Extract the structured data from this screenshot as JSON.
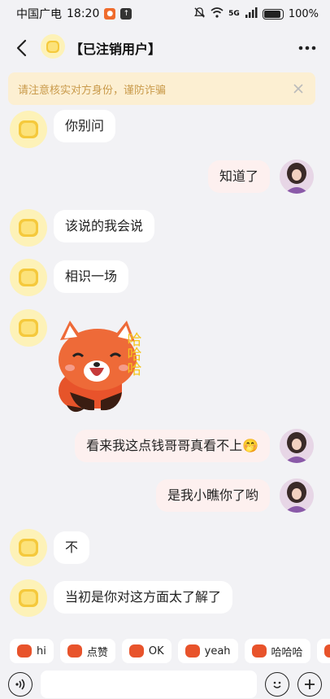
{
  "status_bar": {
    "carrier": "中国广电",
    "time": "18:20",
    "battery": "100%",
    "network": "5G"
  },
  "header": {
    "title": "【已注销用户】"
  },
  "notice": {
    "text": "请注意核实对方身份，谨防诈骗"
  },
  "messages": [
    {
      "side": "left",
      "text": "你别问"
    },
    {
      "side": "right",
      "text": "知道了"
    },
    {
      "side": "left",
      "text": "该说的我会说"
    },
    {
      "side": "left",
      "text": "相识一场"
    },
    {
      "side": "left",
      "sticker": "red-panda-haha-sticker",
      "sticker_text": "哈哈哈"
    },
    {
      "side": "right",
      "text": "看来我这点钱哥哥真看不上🤭"
    },
    {
      "side": "right",
      "text": "是我小瞧你了哟"
    },
    {
      "side": "left",
      "text": "不"
    },
    {
      "side": "left",
      "text": "当初是你对这方面太了解了"
    }
  ],
  "quick_replies": [
    "hi",
    "点赞",
    "OK",
    "yeah",
    "哈哈哈"
  ],
  "input": {
    "value": "",
    "placeholder": ""
  },
  "colors": {
    "background": "#f2f2f5",
    "left_bubble": "#ffffff",
    "right_bubble": "#fdf0ef",
    "notice_bg": "#fcefd2",
    "notice_text": "#c99a4a",
    "bot_avatar": "#fdf2b8"
  }
}
